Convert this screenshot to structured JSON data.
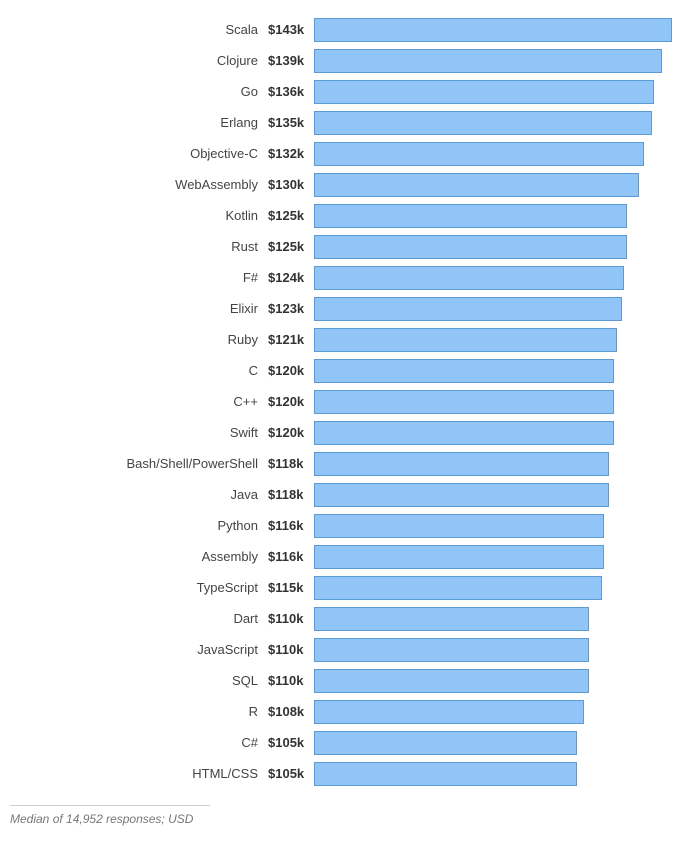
{
  "chart_data": {
    "type": "bar",
    "title": "",
    "xlabel": "",
    "ylabel": "",
    "value_prefix": "$",
    "value_suffix": "k",
    "max_value": 143,
    "series": [
      {
        "name": "Scala",
        "value": 143
      },
      {
        "name": "Clojure",
        "value": 139
      },
      {
        "name": "Go",
        "value": 136
      },
      {
        "name": "Erlang",
        "value": 135
      },
      {
        "name": "Objective-C",
        "value": 132
      },
      {
        "name": "WebAssembly",
        "value": 130
      },
      {
        "name": "Kotlin",
        "value": 125
      },
      {
        "name": "Rust",
        "value": 125
      },
      {
        "name": "F#",
        "value": 124
      },
      {
        "name": "Elixir",
        "value": 123
      },
      {
        "name": "Ruby",
        "value": 121
      },
      {
        "name": "C",
        "value": 120
      },
      {
        "name": "C++",
        "value": 120
      },
      {
        "name": "Swift",
        "value": 120
      },
      {
        "name": "Bash/Shell/PowerShell",
        "value": 118
      },
      {
        "name": "Java",
        "value": 118
      },
      {
        "name": "Python",
        "value": 116
      },
      {
        "name": "Assembly",
        "value": 116
      },
      {
        "name": "TypeScript",
        "value": 115
      },
      {
        "name": "Dart",
        "value": 110
      },
      {
        "name": "JavaScript",
        "value": 110
      },
      {
        "name": "SQL",
        "value": 110
      },
      {
        "name": "R",
        "value": 108
      },
      {
        "name": "C#",
        "value": 105
      },
      {
        "name": "HTML/CSS",
        "value": 105
      }
    ]
  },
  "footer_note": "Median of 14,952 responses; USD"
}
